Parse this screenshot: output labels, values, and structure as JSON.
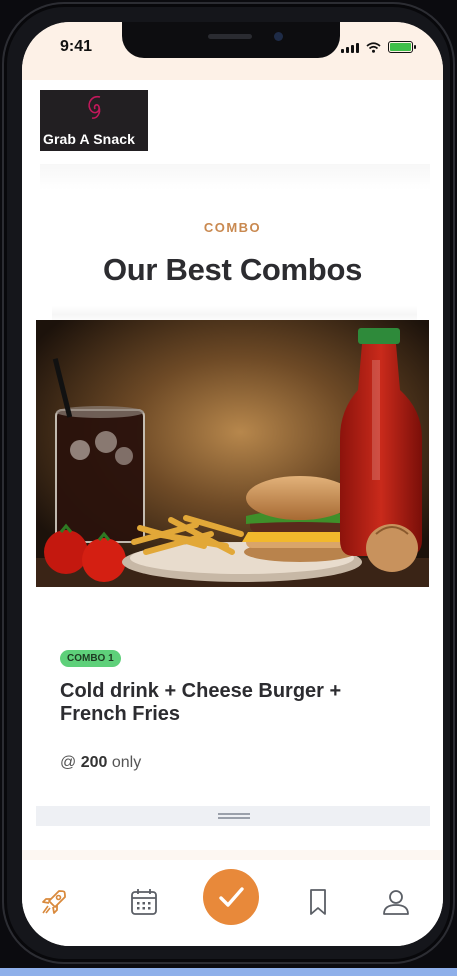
{
  "status_bar": {
    "time": "9:41"
  },
  "brand": {
    "logo_text": "Grab A Snack"
  },
  "section": {
    "eyebrow": "COMBO",
    "title": "Our Best Combos"
  },
  "combo": {
    "badge": "COMBO 1",
    "name": "Cold drink + Cheese Burger + French Fries",
    "price_prefix": "@",
    "price_amount": "200",
    "price_suffix": "only",
    "image_icon": "combo-food-photo"
  },
  "tab_bar": {
    "items": [
      {
        "name": "home",
        "icon": "rocket-icon",
        "active": true
      },
      {
        "name": "calendar",
        "icon": "calendar-icon",
        "active": false
      },
      {
        "name": "confirm",
        "icon": "checkmark-icon",
        "active": false
      },
      {
        "name": "saved",
        "icon": "bookmark-icon",
        "active": false
      },
      {
        "name": "profile",
        "icon": "user-icon",
        "active": false
      }
    ]
  },
  "colors": {
    "accent": "#e8893a",
    "eyebrow": "#c98950",
    "badge_bg": "#5ed07a",
    "title": "#2c2c30"
  }
}
